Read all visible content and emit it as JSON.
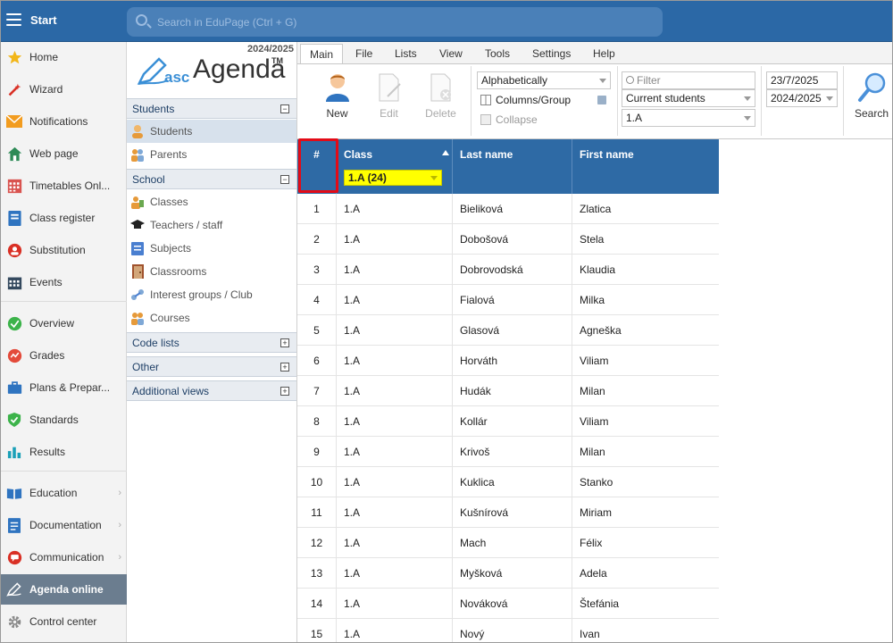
{
  "topbar": {
    "start_label": "Start",
    "search_placeholder": "Search in EduPage (Ctrl + G)"
  },
  "leftnav": {
    "items": [
      {
        "label": "Home",
        "icon": "star-icon",
        "color": "#f2b619"
      },
      {
        "label": "Wizard",
        "icon": "magic-wand-icon",
        "color": "#d93025"
      },
      {
        "label": "Notifications",
        "icon": "envelope-icon",
        "color": "#f29c1f"
      },
      {
        "label": "Web page",
        "icon": "house-icon",
        "color": "#2e8b57"
      },
      {
        "label": "Timetables Onl...",
        "icon": "timetable-icon",
        "color": "#d9534f"
      },
      {
        "label": "Class register",
        "icon": "register-icon",
        "color": "#2f74c0"
      },
      {
        "label": "Substitution",
        "icon": "substitution-icon",
        "color": "#d93025"
      },
      {
        "label": "Events",
        "icon": "calendar-icon",
        "color": "#34495e"
      },
      {
        "label": "Overview",
        "icon": "check-circle-icon",
        "color": "#3cb34a"
      },
      {
        "label": "Grades",
        "icon": "grades-icon",
        "color": "#e34a3a"
      },
      {
        "label": "Plans & Prepar...",
        "icon": "briefcase-icon",
        "color": "#2f74c0"
      },
      {
        "label": "Standards",
        "icon": "shield-check-icon",
        "color": "#3cb34a"
      },
      {
        "label": "Results",
        "icon": "bar-chart-icon",
        "color": "#1aa0b8"
      },
      {
        "label": "Education",
        "icon": "book-icon",
        "color": "#2f74c0"
      },
      {
        "label": "Documentation",
        "icon": "document-icon",
        "color": "#2f74c0"
      },
      {
        "label": "Communication",
        "icon": "communication-icon",
        "color": "#d93025"
      },
      {
        "label": "Agenda online",
        "icon": "agenda-pen-icon",
        "color": "#ffffff"
      },
      {
        "label": "Control center",
        "icon": "gear-icon",
        "color": "#8a8a8a"
      }
    ]
  },
  "col2": {
    "year": "2024/2025",
    "logo_asc": "asc",
    "logo_agenda": "Agenda",
    "logo_tm": "TM",
    "sections": [
      {
        "title": "Students",
        "toggle": "−",
        "items": [
          {
            "label": "Students",
            "icon": "student-icon"
          },
          {
            "label": "Parents",
            "icon": "parents-icon"
          }
        ]
      },
      {
        "title": "School",
        "toggle": "−",
        "items": [
          {
            "label": "Classes",
            "icon": "classes-icon"
          },
          {
            "label": "Teachers / staff",
            "icon": "graduation-cap-icon"
          },
          {
            "label": "Subjects",
            "icon": "subjects-icon"
          },
          {
            "label": "Classrooms",
            "icon": "door-icon"
          },
          {
            "label": "Interest groups / Club",
            "icon": "interest-groups-icon"
          },
          {
            "label": "Courses",
            "icon": "courses-icon"
          }
        ]
      },
      {
        "title": "Code lists",
        "toggle": "+"
      },
      {
        "title": "Other",
        "toggle": "+"
      },
      {
        "title": "Additional views",
        "toggle": "+"
      }
    ]
  },
  "ribbon": {
    "tabs": [
      "Main",
      "File",
      "Lists",
      "View",
      "Tools",
      "Settings",
      "Help"
    ],
    "buttons": [
      {
        "label": "New"
      },
      {
        "label": "Edit"
      },
      {
        "label": "Delete"
      }
    ],
    "sort_value": "Alphabetically",
    "columns_group": "Columns/Group",
    "collapse": "Collapse",
    "filter_placeholder": "Filter",
    "students_filter": "Current students",
    "class_filter": "1.A",
    "date": "23/7/2025",
    "year_select": "2024/2025",
    "search_label": "Search"
  },
  "table": {
    "headers": {
      "num": "#",
      "class": "Class",
      "last_name": "Last name",
      "first_name": "First name"
    },
    "class_filter_value": "1.A (24)",
    "rows": [
      {
        "num": "1",
        "class": "1.A",
        "last": "Bieliková",
        "first": "Zlatica"
      },
      {
        "num": "2",
        "class": "1.A",
        "last": "Dobošová",
        "first": "Stela"
      },
      {
        "num": "3",
        "class": "1.A",
        "last": "Dobrovodská",
        "first": "Klaudia"
      },
      {
        "num": "4",
        "class": "1.A",
        "last": "Fialová",
        "first": "Milka"
      },
      {
        "num": "5",
        "class": "1.A",
        "last": "Glasová",
        "first": "Agneška"
      },
      {
        "num": "6",
        "class": "1.A",
        "last": "Horváth",
        "first": "Viliam"
      },
      {
        "num": "7",
        "class": "1.A",
        "last": "Hudák",
        "first": "Milan"
      },
      {
        "num": "8",
        "class": "1.A",
        "last": "Kollár",
        "first": "Viliam"
      },
      {
        "num": "9",
        "class": "1.A",
        "last": "Krivoš",
        "first": "Milan"
      },
      {
        "num": "10",
        "class": "1.A",
        "last": "Kuklica",
        "first": "Stanko"
      },
      {
        "num": "11",
        "class": "1.A",
        "last": "Kušnírová",
        "first": "Miriam"
      },
      {
        "num": "12",
        "class": "1.A",
        "last": "Mach",
        "first": "Félix"
      },
      {
        "num": "13",
        "class": "1.A",
        "last": "Myšková",
        "first": "Adela"
      },
      {
        "num": "14",
        "class": "1.A",
        "last": "Nováková",
        "first": "Štefánia"
      },
      {
        "num": "15",
        "class": "1.A",
        "last": "Nový",
        "first": "Ivan"
      }
    ]
  }
}
